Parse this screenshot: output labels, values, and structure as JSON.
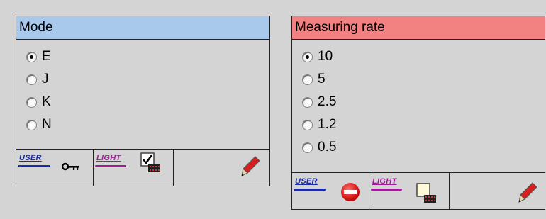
{
  "mode_panel": {
    "title": "Mode",
    "selected": "E",
    "options": [
      "E",
      "J",
      "K",
      "N"
    ],
    "footer": {
      "user_label": "USER",
      "light_label": "LIGHT",
      "user_icon": "key-icon",
      "light_checked": true
    }
  },
  "rate_panel": {
    "title": "Measuring rate",
    "selected": "10",
    "options": [
      "10",
      "5",
      "2.5",
      "1.2",
      "0.5"
    ],
    "footer": {
      "user_label": "USER",
      "light_label": "LIGHT",
      "user_icon": "no-entry-icon",
      "light_checked": false
    }
  },
  "colors": {
    "mode_header": "#a8c8ec",
    "rate_header": "#f28282",
    "user_tag": "#1a2aa8",
    "light_tag": "#a01a9a"
  }
}
